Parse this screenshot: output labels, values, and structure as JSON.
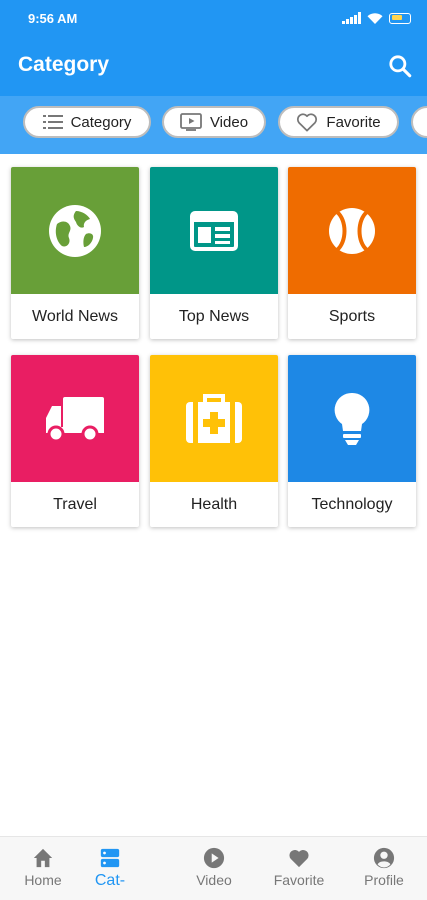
{
  "status_bar": {
    "time": "9:56 AM"
  },
  "app_bar": {
    "title": "Category"
  },
  "chips": [
    {
      "label": "Category",
      "icon": "list-icon"
    },
    {
      "label": "Video",
      "icon": "video-icon"
    },
    {
      "label": "Favorite",
      "icon": "heart-icon"
    }
  ],
  "categories": [
    {
      "label": "World News",
      "color": "#689f38",
      "icon": "globe-icon"
    },
    {
      "label": "Top News",
      "color": "#009688",
      "icon": "newspaper-icon"
    },
    {
      "label": "Sports",
      "color": "#ef6c00",
      "icon": "ball-icon"
    },
    {
      "label": "Travel",
      "color": "#e91e63",
      "icon": "truck-icon"
    },
    {
      "label": "Health",
      "color": "#ffc107",
      "icon": "medkit-icon"
    },
    {
      "label": "Technology",
      "color": "#1e88e5",
      "icon": "bulb-icon"
    }
  ],
  "bottom_nav": {
    "items": [
      {
        "label": "Home",
        "icon": "home-icon"
      },
      {
        "label": "Cat-",
        "icon": "category-icon",
        "active": true
      },
      {
        "label": "Video",
        "icon": "play-icon"
      },
      {
        "label": "Favorite",
        "icon": "heart-icon"
      },
      {
        "label": "Profile",
        "icon": "profile-icon"
      }
    ],
    "active_color": "#2196f3"
  }
}
